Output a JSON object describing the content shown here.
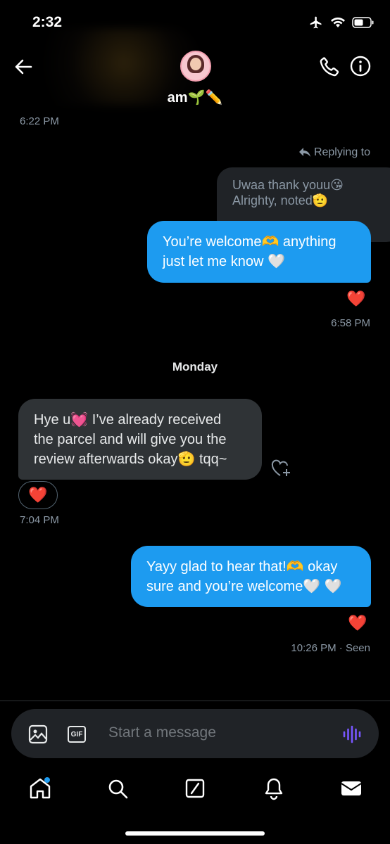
{
  "status_bar": {
    "time": "2:32"
  },
  "header": {
    "name": "am🌱✏️"
  },
  "messages": {
    "ts_top": "6:22 PM",
    "replying_to": "Replying to",
    "quoted_line1": "Uwaa thank youu😘",
    "quoted_line2": "Alrighty, noted🫡",
    "out1_line1": "You’re welcome🫶 anything",
    "out1_line2": "just let me know 🤍",
    "out1_reaction": "❤️",
    "out1_ts": "6:58 PM",
    "day_label": "Monday",
    "in1_line1": "Hye u💓 I’ve already received",
    "in1_line2": "the parcel and will give you the",
    "in1_line3": "review afterwards okay🫡 tqq~",
    "in1_reaction": "❤️",
    "in1_ts": "7:04 PM",
    "out2_line1": "Yayy glad to hear that!🫶 okay",
    "out2_line2": "sure and you’re welcome🤍 🤍",
    "out2_reaction": "❤️",
    "out2_ts": "10:26 PM",
    "out2_seen": "· Seen"
  },
  "composer": {
    "placeholder": "Start a message",
    "gif_label": "GIF"
  },
  "colors": {
    "accent": "#1d9bf0",
    "incoming_bubble": "#2f3336",
    "voice": "#7856ff",
    "notification_dot": "#1d9bf0"
  },
  "icons": [
    "back-arrow-icon",
    "phone-icon",
    "info-icon",
    "reply-icon",
    "add-reaction-icon",
    "image-icon",
    "gif-icon",
    "voice-icon",
    "home-icon",
    "search-icon",
    "grok-icon",
    "bell-icon",
    "mail-icon"
  ]
}
